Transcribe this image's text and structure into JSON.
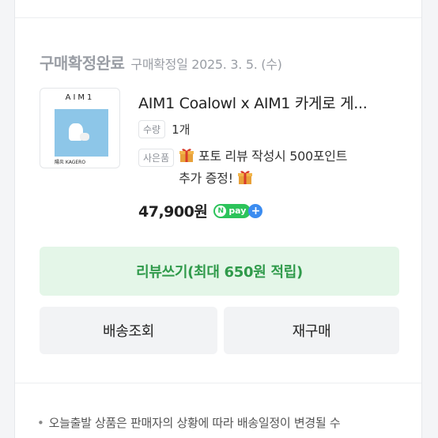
{
  "order": {
    "status": "구매확정완료",
    "confirm_date": "구매확정일 2025. 3. 5. (수)"
  },
  "product": {
    "thumbnail": {
      "title": "AIM1",
      "subtitle": "陽炎 KAGERO"
    },
    "title": "AIM1 Coalowl x AIM1 카게로 게...",
    "quantity_label": "수량",
    "quantity_value": "1개",
    "gift_label": "사은품",
    "gift_text": "포토 리뷰 작성시 500포인트",
    "gift_text_2": "추가 증정!",
    "price": "47,900원",
    "pay_badge": "pay",
    "pay_badge_n": "N",
    "pay_badge_plus": "+"
  },
  "actions": {
    "review": "리뷰쓰기(최대 650원 적립)",
    "shipping": "배송조회",
    "rebuy": "재구매"
  },
  "notice": "오늘출발 상품은 판매자의 상황에 따라 배송일정이 변경될 수",
  "colors": {
    "review_bg": "#e4f6e8",
    "review_text": "#2f9a4a",
    "npay_green": "#2cc35a",
    "npay_blue": "#3b8cf0"
  }
}
